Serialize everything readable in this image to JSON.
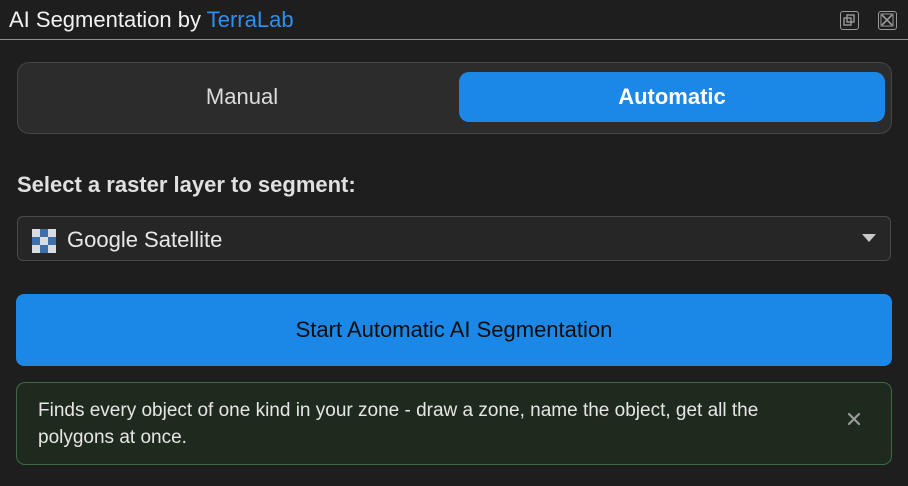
{
  "window": {
    "title_prefix": "AI Segmentation by ",
    "title_brand": "TerraLab",
    "float_icon": "float-window-icon",
    "close_icon": "close-window-icon"
  },
  "mode_toggle": {
    "tabs": [
      {
        "label": "Manual",
        "selected": false
      },
      {
        "label": "Automatic",
        "selected": true
      }
    ]
  },
  "raster": {
    "label": "Select a raster layer to segment:",
    "selected_layer": "Google Satellite",
    "layer_icon": "raster-layer-icon"
  },
  "actions": {
    "start_label": "Start Automatic AI Segmentation"
  },
  "info": {
    "text": "Finds every object of one kind in your zone - draw a zone, name the object, get all the polygons at once.",
    "dismiss_icon": "close-icon"
  },
  "colors": {
    "accent": "#1b87e6",
    "brand": "#2f8ff0",
    "info_border": "#3c6a42",
    "background": "#1e1e1e"
  }
}
